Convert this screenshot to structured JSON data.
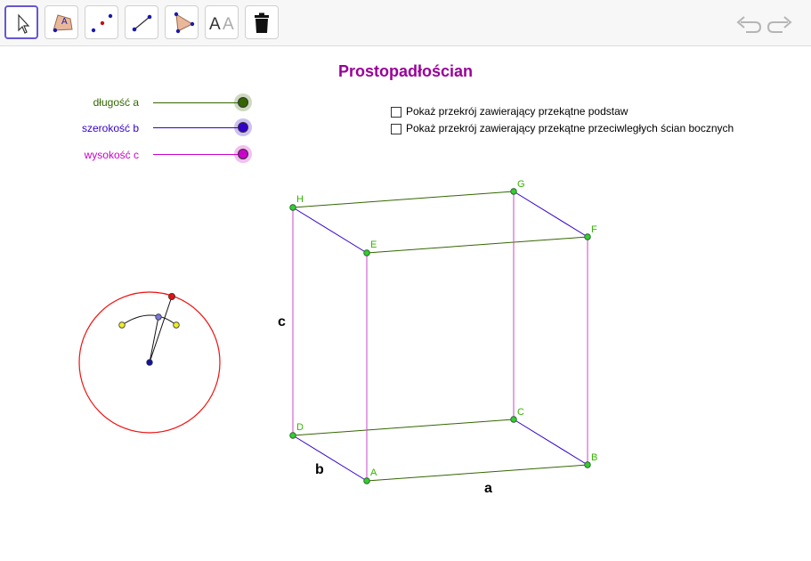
{
  "toolbar": {
    "tools": [
      {
        "name": "move-tool",
        "label": "Move"
      },
      {
        "name": "polygon-tool",
        "label": "A"
      },
      {
        "name": "point-tool",
        "label": "Point"
      },
      {
        "name": "segment-tool",
        "label": "Segment"
      },
      {
        "name": "triangle-tool",
        "label": "Polygon"
      },
      {
        "name": "text-tool",
        "label_dark": "A",
        "label_light": "A"
      },
      {
        "name": "delete-tool",
        "label": "Delete"
      }
    ],
    "undo_label": "Undo",
    "redo_label": "Redo"
  },
  "title": "Prostopadłościan",
  "sliders": [
    {
      "label": "długość a",
      "color": "#336600"
    },
    {
      "label": "szerokość b",
      "color": "#3300cc"
    },
    {
      "label": "wysokość c",
      "color": "#cc00cc"
    }
  ],
  "checkboxes": [
    {
      "label": "Pokaż przekrój zawierający przekątne podstaw",
      "checked": false
    },
    {
      "label": "Pokaż przekrój zawierający przekątne przeciwległych ścian bocznych",
      "checked": false
    }
  ],
  "figure": {
    "vertices": [
      "A",
      "B",
      "C",
      "D",
      "E",
      "F",
      "G",
      "H"
    ],
    "edge_labels": {
      "a": "a",
      "b": "b",
      "c": "c"
    },
    "colors": {
      "length_edges": "#336600",
      "width_edges": "#3300cc",
      "height_edges": "#cc44cc",
      "vertex_fill": "#33cc33",
      "circle": "#ee1111"
    }
  }
}
